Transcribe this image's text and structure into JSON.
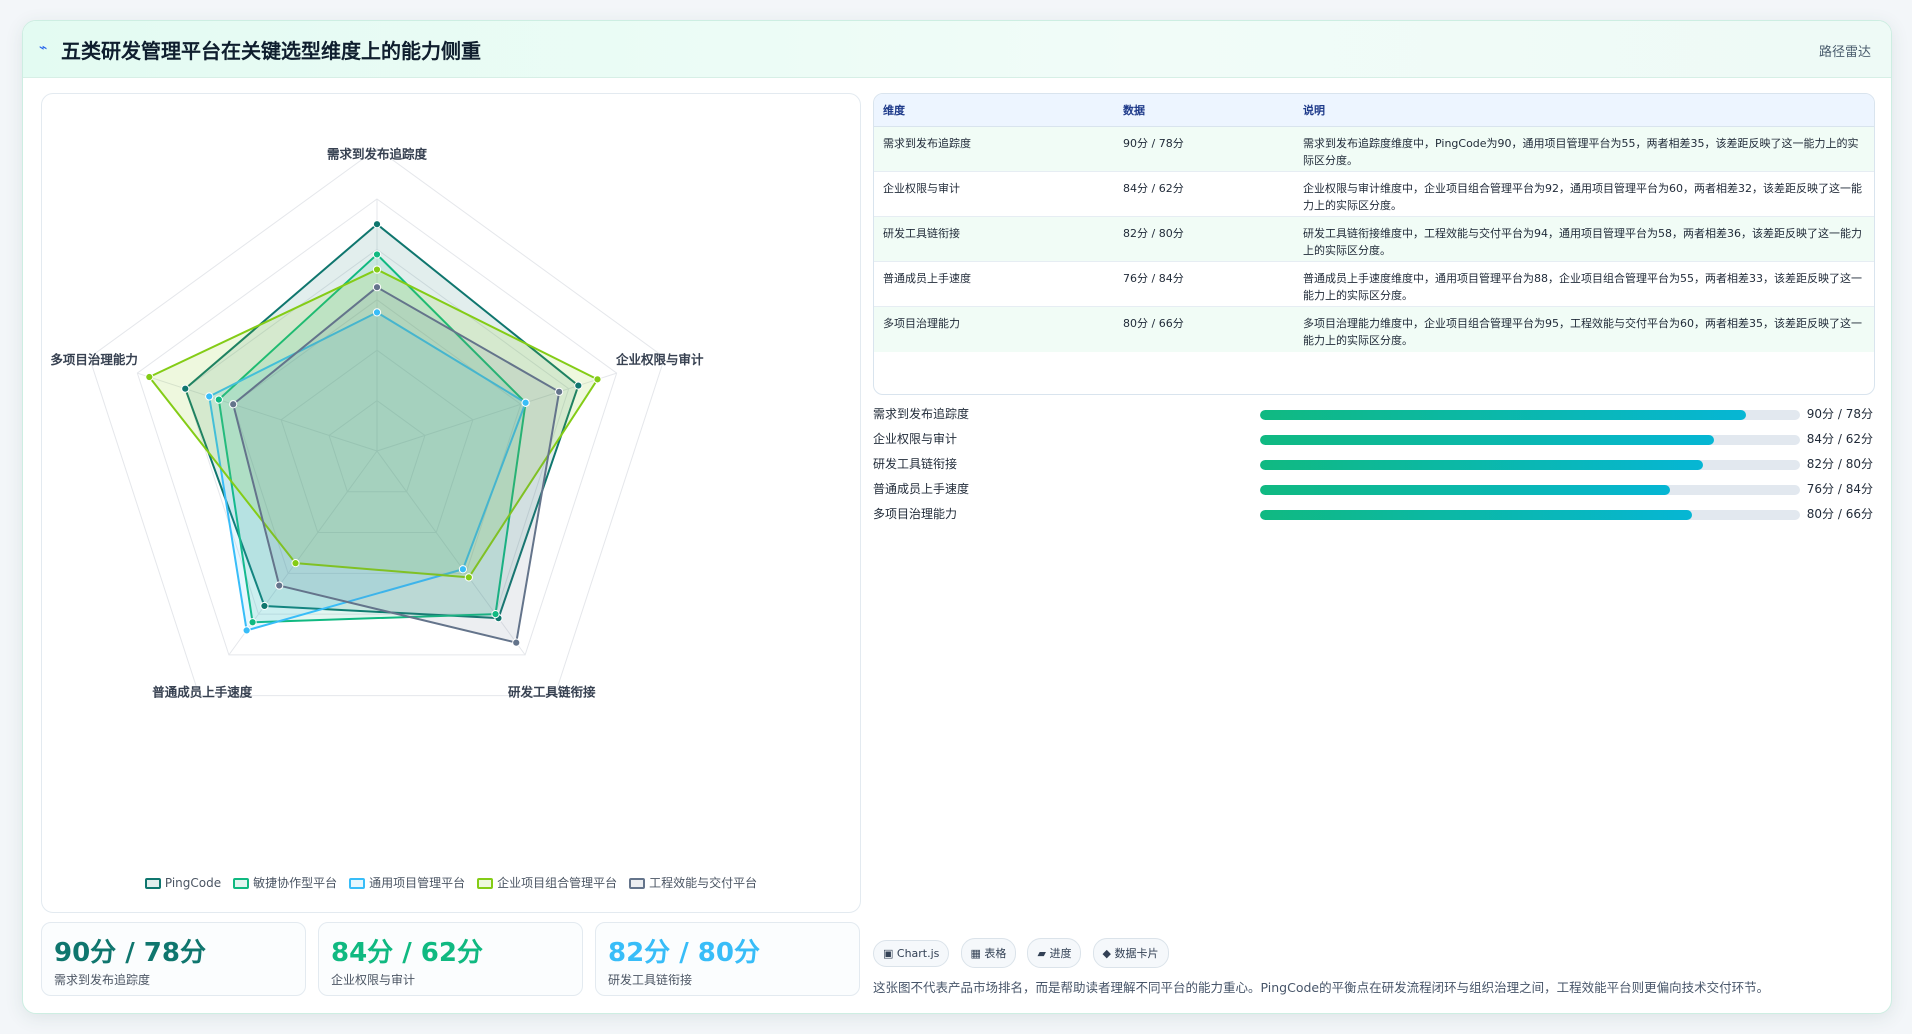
{
  "header": {
    "flag_icon": "⌁",
    "title": "五类研发管理平台在关键选型维度上的能力侧重",
    "mode": "路径雷达"
  },
  "chart_data": {
    "type": "radar",
    "axes": [
      "需求到发布追踪度",
      "企业权限与审计",
      "研发工具链衔接",
      "普通成员上手速度",
      "多项目治理能力"
    ],
    "range": [
      0,
      100
    ],
    "rings": 5,
    "series": [
      {
        "name": "PingCode",
        "values": [
          90,
          84,
          82,
          76,
          80
        ],
        "color": "#0f766e",
        "fill": "rgba(15,118,110,0.12)"
      },
      {
        "name": "敏捷协作型平台",
        "values": [
          78,
          62,
          80,
          84,
          66
        ],
        "color": "#10b981",
        "fill": "rgba(16,185,129,0.12)"
      },
      {
        "name": "通用项目管理平台",
        "values": [
          55,
          62,
          58,
          88,
          70
        ],
        "color": "#38bdf8",
        "fill": "rgba(56,189,248,0.12)"
      },
      {
        "name": "企业项目组合管理平台",
        "values": [
          72,
          92,
          62,
          55,
          95
        ],
        "color": "#84cc16",
        "fill": "rgba(132,204,22,0.14)"
      },
      {
        "name": "工程效能与交付平台",
        "values": [
          65,
          76,
          94,
          66,
          60
        ],
        "color": "#64748b",
        "fill": "rgba(100,116,139,0.12)"
      }
    ]
  },
  "kpis": [
    {
      "value": "90分 / 78分",
      "label": "需求到发布追踪度",
      "color": "#0f766e"
    },
    {
      "value": "84分 / 62分",
      "label": "企业权限与审计",
      "color": "#10b981"
    },
    {
      "value": "82分 / 80分",
      "label": "研发工具链衔接",
      "color": "#38bdf8"
    }
  ],
  "table": {
    "headers": [
      "维度",
      "数据",
      "说明"
    ],
    "rows": [
      [
        "需求到发布追踪度",
        "90分 / 78分",
        "需求到发布追踪度维度中，PingCode为90，通用项目管理平台为55，两者相差35，该差距反映了这一能力上的实际区分度。"
      ],
      [
        "企业权限与审计",
        "84分 / 62分",
        "企业权限与审计维度中，企业项目组合管理平台为92，通用项目管理平台为60，两者相差32，该差距反映了这一能力上的实际区分度。"
      ],
      [
        "研发工具链衔接",
        "82分 / 80分",
        "研发工具链衔接维度中，工程效能与交付平台为94，通用项目管理平台为58，两者相差36，该差距反映了这一能力上的实际区分度。"
      ],
      [
        "普通成员上手速度",
        "76分 / 84分",
        "普通成员上手速度维度中，通用项目管理平台为88，企业项目组合管理平台为55，两者相差33，该差距反映了这一能力上的实际区分度。"
      ],
      [
        "多项目治理能力",
        "80分 / 66分",
        "多项目治理能力维度中，企业项目组合管理平台为95，工程效能与交付平台为60，两者相差35，该差距反映了这一能力上的实际区分度。"
      ]
    ]
  },
  "bars": [
    {
      "label": "需求到发布追踪度",
      "value": 90,
      "text": "90分 / 78分"
    },
    {
      "label": "企业权限与审计",
      "value": 84,
      "text": "84分 / 62分"
    },
    {
      "label": "研发工具链衔接",
      "value": 82,
      "text": "82分 / 80分"
    },
    {
      "label": "普通成员上手速度",
      "value": 76,
      "text": "76分 / 84分"
    },
    {
      "label": "多项目治理能力",
      "value": 80,
      "text": "80分 / 66分"
    }
  ],
  "tags": [
    "▣ Chart.js",
    "▦ 表格",
    "▰ 进度",
    "◆ 数据卡片"
  ],
  "note": "这张图不代表产品市场排名，而是帮助读者理解不同平台的能力重心。PingCode的平衡点在研发流程闭环与组织治理之间，工程效能平台则更偏向技术交付环节。"
}
